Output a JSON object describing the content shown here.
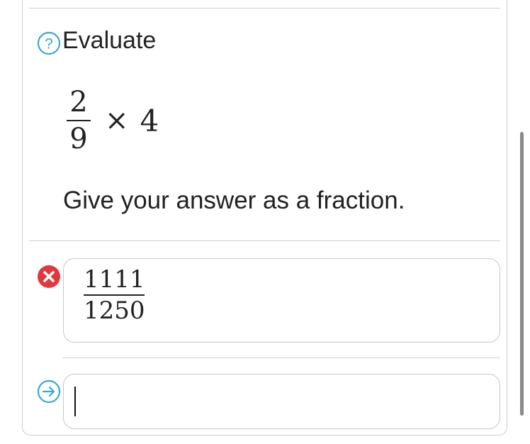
{
  "question": {
    "prompt": "Evaluate",
    "expression": {
      "numerator": "2",
      "denominator": "9",
      "operator": "×",
      "multiplier": "4"
    },
    "instruction": "Give your answer as a fraction."
  },
  "previous_answer": {
    "status": "incorrect",
    "numerator": "1111",
    "denominator": "1250"
  },
  "answer_input": {
    "value": ""
  },
  "icons": {
    "help": "question-circle-icon",
    "incorrect": "x-circle-icon",
    "submit": "arrow-circle-icon"
  },
  "colors": {
    "accent": "#3aa7d9",
    "error": "#e0383e",
    "text": "#222222",
    "border": "#cfcfcf"
  }
}
